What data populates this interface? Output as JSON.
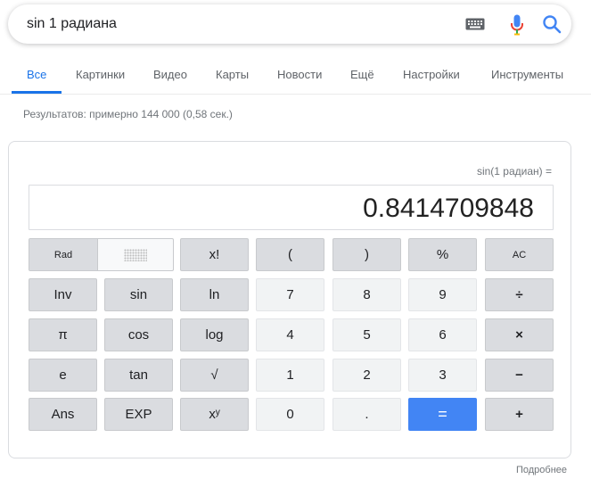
{
  "search": {
    "query": "sin 1 радиана"
  },
  "icons": {
    "keyboard": "keyboard-icon",
    "mic": "mic-icon",
    "search": "search-icon"
  },
  "colors": {
    "accent": "#1a73e8",
    "equals_button": "#4285f4",
    "mic_red": "#ea4335",
    "mic_blue": "#4285f4"
  },
  "tabs": [
    {
      "label": "Все",
      "active": true
    },
    {
      "label": "Картинки"
    },
    {
      "label": "Видео"
    },
    {
      "label": "Карты"
    },
    {
      "label": "Новости"
    },
    {
      "label": "Ещё"
    },
    {
      "label": "Настройки"
    },
    {
      "label": "Инструменты"
    }
  ],
  "result_stats": "Результатов: примерно 144 000 (0,58 сек.)",
  "calculator": {
    "expression": "sin(1 радиан) =",
    "display": "0.8414709848",
    "mode_rad_label": "Rad",
    "keys": {
      "fact": "x!",
      "lparen": "(",
      "rparen": ")",
      "percent": "%",
      "ac": "AC",
      "inv": "Inv",
      "sin": "sin",
      "ln": "ln",
      "seven": "7",
      "eight": "8",
      "nine": "9",
      "divide": "÷",
      "pi": "π",
      "cos": "cos",
      "log": "log",
      "four": "4",
      "five": "5",
      "six": "6",
      "multiply": "×",
      "e": "e",
      "tan": "tan",
      "sqrt": "√",
      "one": "1",
      "two": "2",
      "three": "3",
      "minus": "−",
      "ans": "Ans",
      "exp": "EXP",
      "power": "xʸ",
      "zero": "0",
      "dot": ".",
      "equals": "=",
      "plus": "+"
    }
  },
  "more_link": "Подробнее"
}
